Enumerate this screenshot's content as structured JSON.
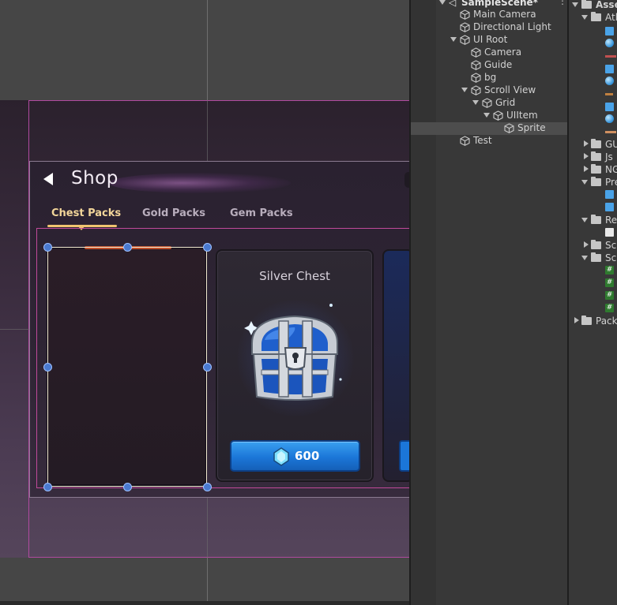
{
  "scene": {
    "shop": {
      "title": "Shop",
      "tabs": [
        "Chest Packs",
        "Gold Packs",
        "Gem Packs"
      ],
      "active_tab": "Chest Packs",
      "cards": [
        {
          "title": "",
          "state": "selected-empty"
        },
        {
          "title": "Silver Chest",
          "price": "600",
          "currency_icon": "gem-icon",
          "item_icon": "chest-icon"
        }
      ]
    }
  },
  "hierarchy": {
    "scene_name": "SampleScene*",
    "items": [
      {
        "label": "Main Camera",
        "depth": 1,
        "expand": "none"
      },
      {
        "label": "Directional Light",
        "depth": 1,
        "expand": "none"
      },
      {
        "label": "UI Root",
        "depth": 1,
        "expand": "open"
      },
      {
        "label": "Camera",
        "depth": 2,
        "expand": "none"
      },
      {
        "label": "Guide",
        "depth": 2,
        "expand": "none"
      },
      {
        "label": "bg",
        "depth": 2,
        "expand": "none"
      },
      {
        "label": "Scroll View",
        "depth": 2,
        "expand": "open"
      },
      {
        "label": "Grid",
        "depth": 3,
        "expand": "open"
      },
      {
        "label": "UIItem",
        "depth": 4,
        "expand": "open"
      },
      {
        "label": "Sprite",
        "depth": 5,
        "expand": "none",
        "selected": true
      },
      {
        "label": "Test",
        "depth": 1,
        "expand": "none"
      }
    ]
  },
  "project": {
    "root": "Asse",
    "items": [
      {
        "label": "Atl",
        "type": "folder-open"
      },
      {
        "label": "GU",
        "type": "folder"
      },
      {
        "label": "Js",
        "type": "folder"
      },
      {
        "label": "NG",
        "type": "folder"
      },
      {
        "label": "Pre",
        "type": "folder-open"
      },
      {
        "label": "Re",
        "type": "folder-open"
      },
      {
        "label": "Sc",
        "type": "folder"
      },
      {
        "label": "Sc",
        "type": "folder-open"
      },
      {
        "label": "Pack",
        "type": "folder"
      }
    ]
  },
  "colors": {
    "accent_tab": "#f3d69a",
    "price_button": "#1b76d8",
    "selection_handle": "#4a7ad0",
    "rect_outline": "#c04a9a"
  }
}
